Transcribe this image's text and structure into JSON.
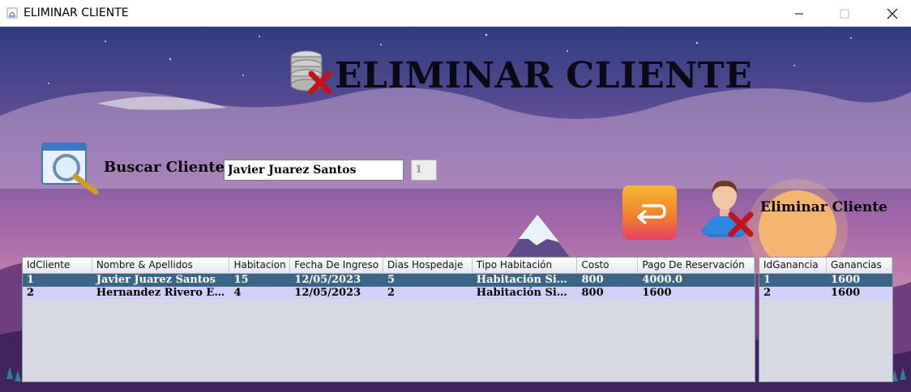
{
  "window": {
    "title": "ELIMINAR CLIENTE",
    "app_icon": "java-app-icon",
    "controls": [
      "minimize-icon",
      "maximize-icon",
      "close-icon"
    ]
  },
  "header": {
    "title": "ELIMINAR CLIENTE",
    "icon": "database-delete-icon"
  },
  "search": {
    "icon": "magnifier-window-icon",
    "label": "Buscar Cliente",
    "value": "Javier Juarez Santos",
    "id_value": "1"
  },
  "actions": {
    "back_icon": "return-arrow-icon",
    "delete_icon": "user-delete-icon",
    "delete_label": "Eliminar Cliente"
  },
  "clients_table": {
    "columns": [
      "IdCliente",
      "Nombre & Apellidos",
      "Habitacion",
      "Fecha De Ingreso",
      "Dias Hospedaje",
      "Tipo Habitación",
      "Costo",
      "Pago De  Reservación"
    ],
    "rows": [
      [
        "1",
        "Javier Juarez Santos",
        "15",
        "12/05/2023",
        "5",
        "Habitación Simple",
        "800",
        "4000.0"
      ],
      [
        "2",
        "Hernandez Rivero Emm...",
        "4",
        "12/05/2023",
        "2",
        "Habitación Simple",
        "800",
        "1600"
      ]
    ],
    "selected_row": 0
  },
  "gains_table": {
    "columns": [
      "IdGanancia",
      "Ganancias"
    ],
    "rows": [
      [
        "1",
        "1600"
      ],
      [
        "2",
        "1600"
      ]
    ],
    "selected_row": 0
  },
  "colors": {
    "selected_row": "#3b6584",
    "alt_row": "#d1d0f7",
    "table_bg": "#d6d9e2"
  }
}
